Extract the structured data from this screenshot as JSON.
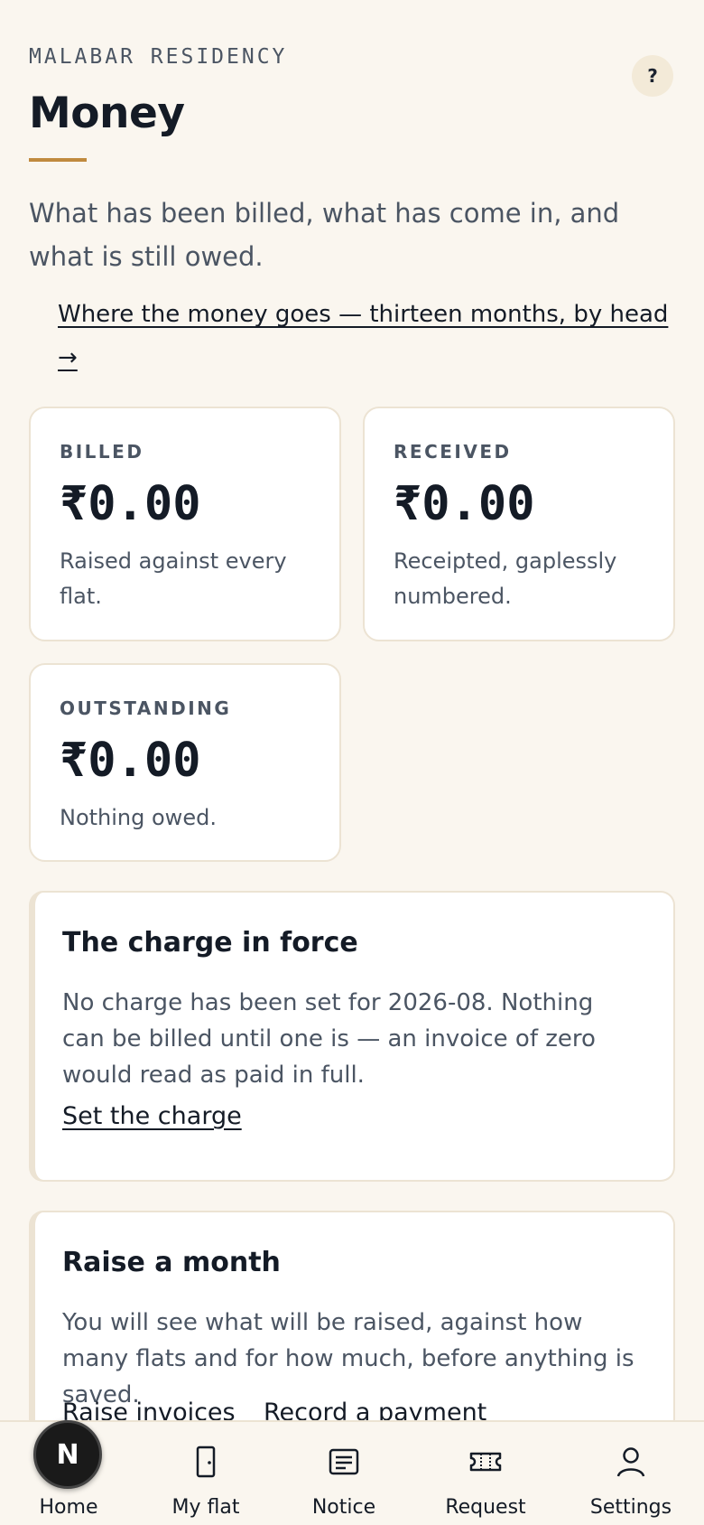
{
  "header": {
    "eyebrow": "MALABAR RESIDENCY",
    "help_label": "?",
    "title": "Money",
    "lede": "What has been billed, what has come in, and what is still owed.",
    "trend_link": "Where the money goes — thirteen months, by head →"
  },
  "stats": [
    {
      "label": "BILLED",
      "amount": "₹0.00",
      "note": "Raised against every flat."
    },
    {
      "label": "RECEIVED",
      "amount": "₹0.00",
      "note": "Receipted, gaplessly numbered."
    },
    {
      "label": "OUTSTANDING",
      "amount": "₹0.00",
      "note": "Nothing owed."
    }
  ],
  "charge_panel": {
    "title": "The charge in force",
    "body": "No charge has been set for 2026-08. Nothing can be billed until one is — an invoice of zero would read as paid in full.",
    "action": "Set the charge"
  },
  "raise_panel": {
    "title": "Raise a month",
    "body": "You will see what will be raised, against how many flats and for how much, before anything is saved.",
    "action_raise": "Raise invoices",
    "action_record": "Record a payment"
  },
  "nav": {
    "home_badge": "N",
    "items": [
      {
        "label": "Home",
        "icon": "home-icon"
      },
      {
        "label": "My flat",
        "icon": "door-icon"
      },
      {
        "label": "Notice",
        "icon": "notice-icon"
      },
      {
        "label": "Request",
        "icon": "ticket-icon"
      },
      {
        "label": "Settings",
        "icon": "person-icon"
      }
    ]
  },
  "colors": {
    "background": "#faf6ef",
    "accent": "#c08a3e",
    "card_border": "#ece3d3",
    "ink": "#141b26"
  }
}
